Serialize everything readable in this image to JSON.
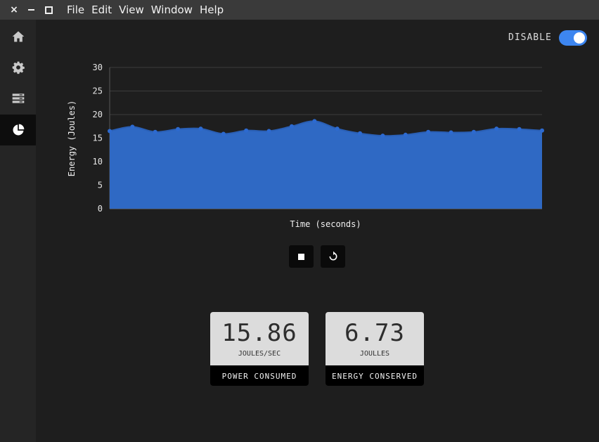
{
  "window": {
    "menu": [
      "File",
      "Edit",
      "View",
      "Window",
      "Help"
    ]
  },
  "sidebar": {
    "items": [
      {
        "icon": "home-icon"
      },
      {
        "icon": "gear-icon"
      },
      {
        "icon": "server-icon"
      },
      {
        "icon": "pie-chart-icon",
        "active": true
      }
    ]
  },
  "toggle": {
    "label": "DISABLE",
    "on": true,
    "color": "#3d86f0"
  },
  "chart_data": {
    "type": "area",
    "xlabel": "Time (seconds)",
    "ylabel": "Energy (Joules)",
    "ylim": [
      0,
      30
    ],
    "yticks": [
      0,
      5,
      10,
      15,
      20,
      25,
      30
    ],
    "grid": true,
    "color": "#2f69c4",
    "values": [
      16.5,
      17.4,
      16.3,
      16.9,
      17.0,
      15.9,
      16.6,
      16.5,
      17.5,
      18.6,
      17.0,
      16.0,
      15.5,
      15.7,
      16.3,
      16.2,
      16.3,
      17.0,
      16.9,
      16.6
    ]
  },
  "controls": {
    "stop": "stop-icon",
    "reset": "reset-icon"
  },
  "stats": {
    "power": {
      "value": "15.86",
      "unit": "JOULES/SEC",
      "label": "POWER CONSUMED"
    },
    "energy": {
      "value": "6.73",
      "unit": "JOULLES",
      "label": "ENERGY CONSERVED"
    }
  }
}
